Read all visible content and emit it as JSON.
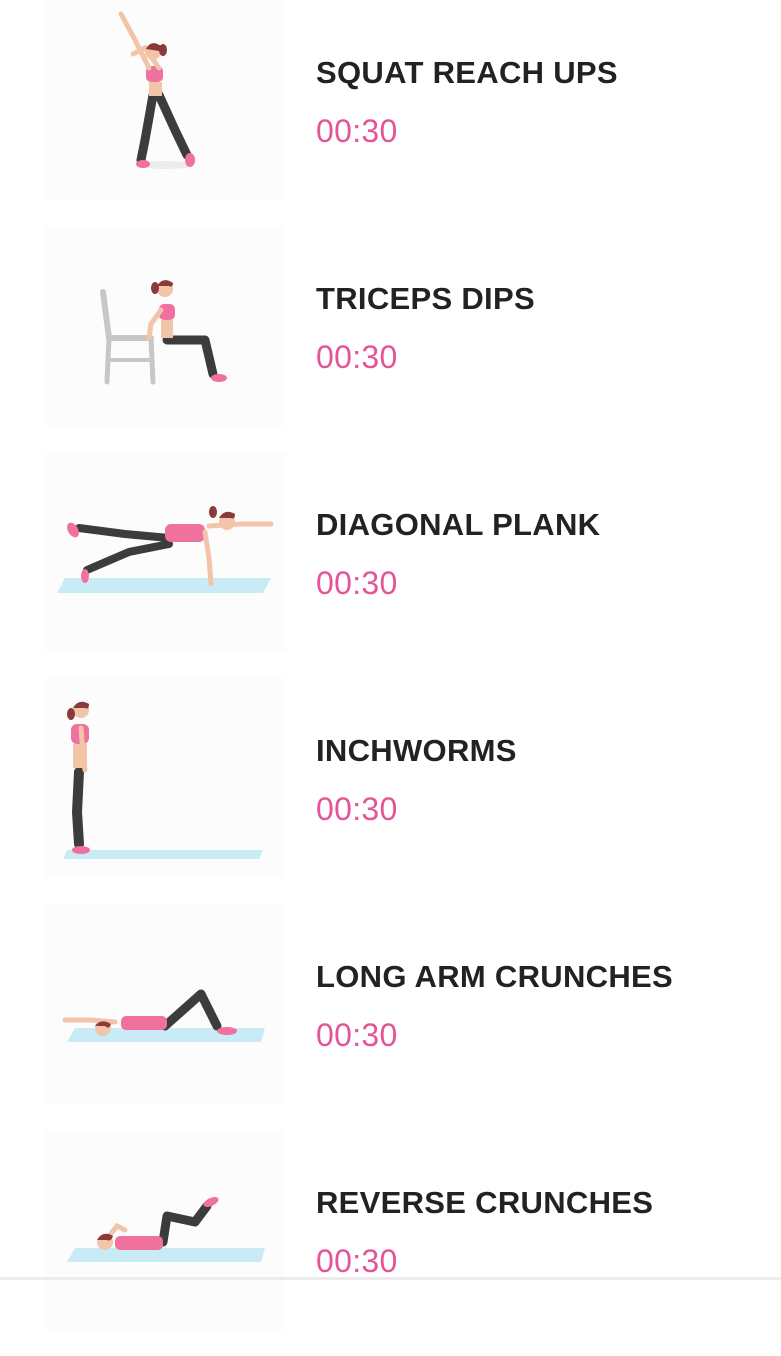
{
  "colors": {
    "accent": "#e45597",
    "title": "#222222",
    "mat": "#c8ebf6",
    "skin": "#f2c4a8",
    "top": "#f0709e",
    "pants": "#3c3c3c",
    "hair": "#8a3a3a",
    "chair": "#c7c7c7"
  },
  "exercises": [
    {
      "name": "SQUAT REACH UPS",
      "duration": "00:30",
      "icon": "woman-reaching-up-icon"
    },
    {
      "name": "TRICEPS DIPS",
      "duration": "00:30",
      "icon": "woman-chair-dip-icon"
    },
    {
      "name": "DIAGONAL PLANK",
      "duration": "00:30",
      "icon": "woman-plank-icon"
    },
    {
      "name": "INCHWORMS",
      "duration": "00:30",
      "icon": "woman-standing-icon"
    },
    {
      "name": "LONG ARM CRUNCHES",
      "duration": "00:30",
      "icon": "woman-lying-crunch-icon"
    },
    {
      "name": "REVERSE CRUNCHES",
      "duration": "00:30",
      "icon": "woman-reverse-crunch-icon"
    }
  ]
}
